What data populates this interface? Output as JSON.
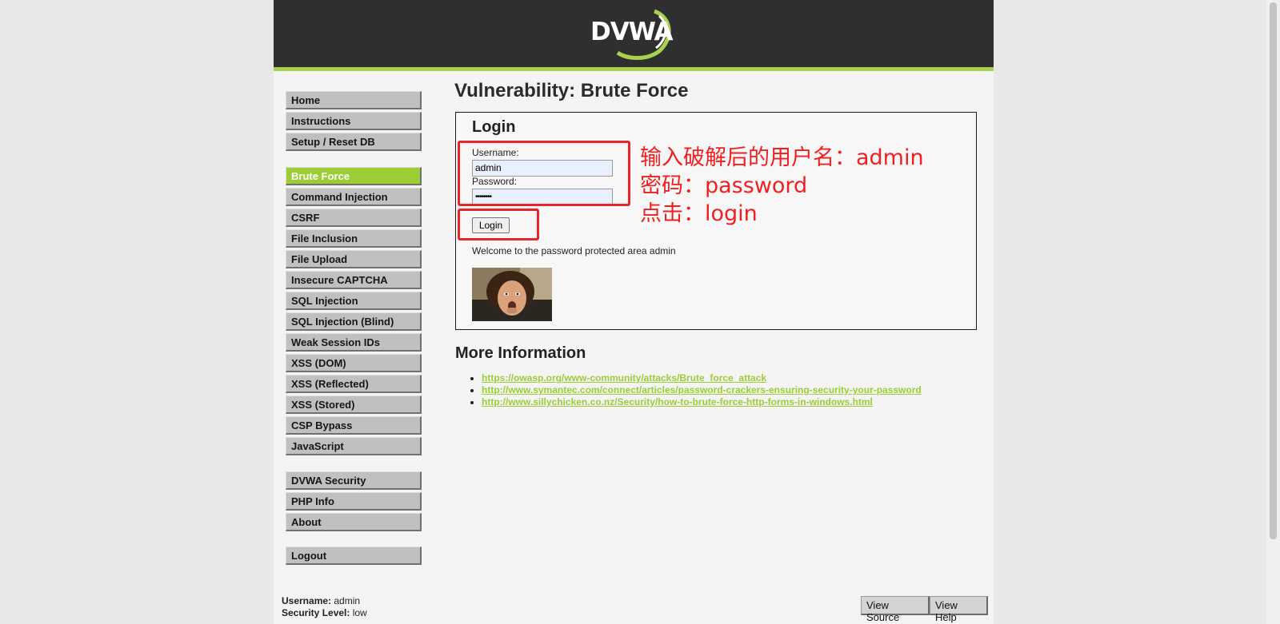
{
  "header": {
    "logo_text": "DVWA"
  },
  "menu": {
    "group1": [
      {
        "label": "Home"
      },
      {
        "label": "Instructions"
      },
      {
        "label": "Setup / Reset DB"
      }
    ],
    "group2": [
      {
        "label": "Brute Force",
        "selected": true
      },
      {
        "label": "Command Injection"
      },
      {
        "label": "CSRF"
      },
      {
        "label": "File Inclusion"
      },
      {
        "label": "File Upload"
      },
      {
        "label": "Insecure CAPTCHA"
      },
      {
        "label": "SQL Injection"
      },
      {
        "label": "SQL Injection (Blind)"
      },
      {
        "label": "Weak Session IDs"
      },
      {
        "label": "XSS (DOM)"
      },
      {
        "label": "XSS (Reflected)"
      },
      {
        "label": "XSS (Stored)"
      },
      {
        "label": "CSP Bypass"
      },
      {
        "label": "JavaScript"
      }
    ],
    "group3": [
      {
        "label": "DVWA Security"
      },
      {
        "label": "PHP Info"
      },
      {
        "label": "About"
      }
    ],
    "group4": [
      {
        "label": "Logout"
      }
    ]
  },
  "main": {
    "title": "Vulnerability: Brute Force",
    "login": {
      "heading": "Login",
      "username_label": "Username:",
      "username_value": "admin",
      "password_label": "Password:",
      "password_value": "••••••••",
      "button_label": "Login",
      "welcome": "Welcome to the password protected area admin"
    },
    "more_info": {
      "title": "More Information",
      "links": [
        "https://owasp.org/www-community/attacks/Brute_force_attack",
        "http://www.symantec.com/connect/articles/password-crackers-ensuring-security-your-password",
        "http://www.sillychicken.co.nz/Security/how-to-brute-force-http-forms-in-windows.html"
      ]
    }
  },
  "annotation": {
    "line1": "输入破解后的用户名：admin",
    "line2": "密码：password",
    "line3": "点击：login",
    "color": "#f02020"
  },
  "footer": {
    "username_label": "Username:",
    "username_value": "admin",
    "security_label": "Security Level:",
    "security_value": "low",
    "view_source": "View Source",
    "view_help": "View Help"
  },
  "colors": {
    "accent": "#9ccd35",
    "header_bg": "#2f2f2f"
  }
}
